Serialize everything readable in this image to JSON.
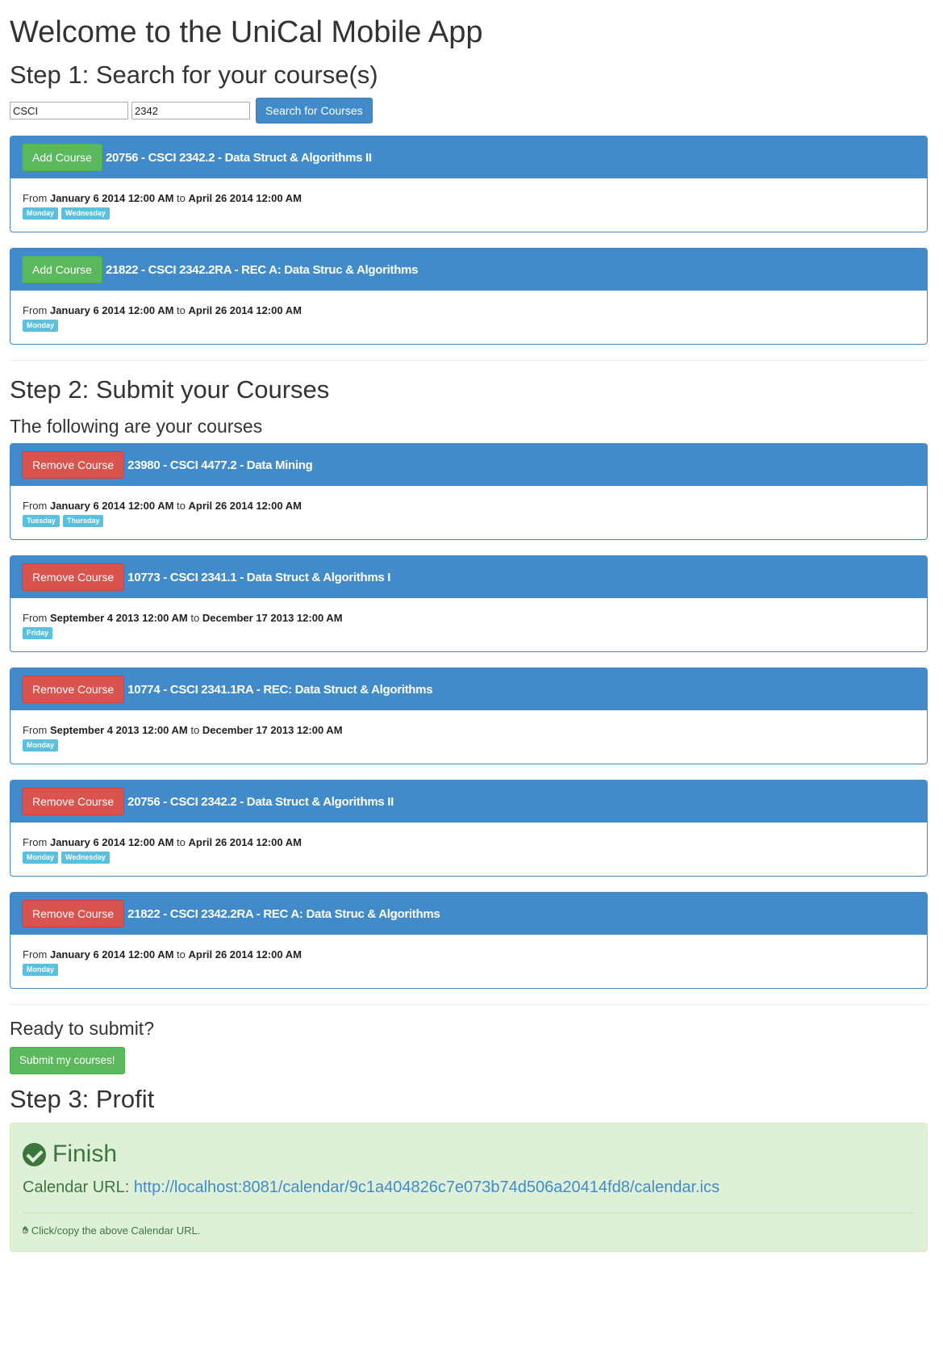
{
  "header": {
    "title": "Welcome to the UniCal Mobile App"
  },
  "step1": {
    "heading": "Step 1: Search for your course(s)",
    "subject_value": "CSCI",
    "number_value": "2342",
    "search_label": "Search for Courses"
  },
  "search_results": [
    {
      "action": "Add Course",
      "title": "20756 - CSCI 2342.2 - Data Struct & Algorithms II",
      "from_label": "From",
      "start": "January 6 2014 12:00 AM",
      "to_label": "to",
      "end": "April 26 2014 12:00 AM",
      "days": [
        "Monday",
        "Wednesday"
      ]
    },
    {
      "action": "Add Course",
      "title": "21822 - CSCI 2342.2RA - REC A: Data Struc & Algorithms",
      "from_label": "From",
      "start": "January 6 2014 12:00 AM",
      "to_label": "to",
      "end": "April 26 2014 12:00 AM",
      "days": [
        "Monday"
      ]
    }
  ],
  "step2": {
    "heading": "Step 2: Submit your Courses",
    "subheading": "The following are your courses"
  },
  "my_courses": [
    {
      "action": "Remove Course",
      "title": "23980 - CSCI 4477.2 - Data Mining",
      "from_label": "From",
      "start": "January 6 2014 12:00 AM",
      "to_label": "to",
      "end": "April 26 2014 12:00 AM",
      "days": [
        "Tuesday",
        "Thursday"
      ]
    },
    {
      "action": "Remove Course",
      "title": "10773 - CSCI 2341.1 - Data Struct & Algorithms I",
      "from_label": "From",
      "start": "September 4 2013 12:00 AM",
      "to_label": "to",
      "end": "December 17 2013 12:00 AM",
      "days": [
        "Friday"
      ]
    },
    {
      "action": "Remove Course",
      "title": "10774 - CSCI 2341.1RA - REC: Data Struct & Algorithms",
      "from_label": "From",
      "start": "September 4 2013 12:00 AM",
      "to_label": "to",
      "end": "December 17 2013 12:00 AM",
      "days": [
        "Monday"
      ]
    },
    {
      "action": "Remove Course",
      "title": "20756 - CSCI 2342.2 - Data Struct & Algorithms II",
      "from_label": "From",
      "start": "January 6 2014 12:00 AM",
      "to_label": "to",
      "end": "April 26 2014 12:00 AM",
      "days": [
        "Monday",
        "Wednesday"
      ]
    },
    {
      "action": "Remove Course",
      "title": "21822 - CSCI 2342.2RA - REC A: Data Struc & Algorithms",
      "from_label": "From",
      "start": "January 6 2014 12:00 AM",
      "to_label": "to",
      "end": "April 26 2014 12:00 AM",
      "days": [
        "Monday"
      ]
    }
  ],
  "ready": {
    "heading": "Ready to submit?",
    "submit_label": "Submit my courses!"
  },
  "step3": {
    "heading": "Step 3: Profit",
    "finish_title": "Finish",
    "calendar_label": "Calendar URL:",
    "calendar_url": "http://localhost:8081/calendar/9c1a404826c7e073b74d506a20414fd8/calendar.ics",
    "hint": "Click/copy the above Calendar URL."
  },
  "icons": {
    "finish": "check-circle-icon",
    "hint": "hand-pointer-icon"
  },
  "colors": {
    "primary": "#428bca",
    "success": "#5cb85c",
    "danger": "#d9534f",
    "info": "#5bc0de",
    "alert_bg": "#dff0d8",
    "alert_text": "#3c763d"
  }
}
